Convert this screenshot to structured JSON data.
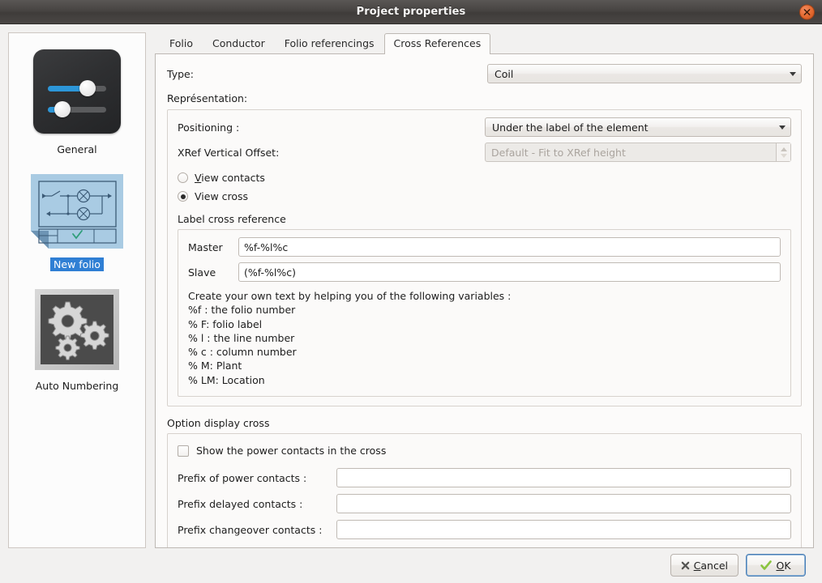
{
  "window": {
    "title": "Project properties",
    "close_icon": "close-icon"
  },
  "sidebar": {
    "items": [
      {
        "label": "General",
        "icon": "sliders-icon",
        "selected": false
      },
      {
        "label": "New folio",
        "icon": "schematic-folio-icon",
        "selected": true
      },
      {
        "label": "Auto Numbering",
        "icon": "gears-icon",
        "selected": false
      }
    ]
  },
  "tabs": [
    {
      "label": "Folio",
      "active": false
    },
    {
      "label": "Conductor",
      "active": false
    },
    {
      "label": "Folio referencings",
      "active": false
    },
    {
      "label": "Cross References",
      "active": true
    }
  ],
  "cross_references": {
    "type_label": "Type:",
    "type_value": "Coil",
    "representation_label": "Représentation:",
    "positioning_label": "Positioning :",
    "positioning_value": "Under the label of the element",
    "xref_offset_label": "XRef Vertical Offset:",
    "xref_offset_placeholder": "Default - Fit to XRef height",
    "xref_offset_value": "",
    "radio_view_contacts": "View contacts",
    "radio_view_contacts_selected": false,
    "radio_view_cross": "View cross",
    "radio_view_cross_selected": true,
    "label_cross_reference_group": "Label cross reference",
    "master_label": "Master",
    "master_value": "%f-%l%c",
    "slave_label": "Slave",
    "slave_value": "(%f-%l%c)",
    "help_text": "Create your own text by helping you of the following variables :\n%f : the folio number\n% F: folio label\n% l : the line number\n% c : column number\n% M: Plant\n% LM: Location",
    "option_display_group": "Option display cross",
    "show_power_contacts_label": "Show the power contacts in the cross",
    "show_power_contacts_checked": false,
    "prefix_power_label": "Prefix of power contacts :",
    "prefix_power_value": "",
    "prefix_delayed_label": "Prefix delayed contacts :",
    "prefix_delayed_value": "",
    "prefix_changeover_label": "Prefix changeover contacts :",
    "prefix_changeover_value": ""
  },
  "buttons": {
    "cancel": "Cancel",
    "cancel_icon": "cross-mark-icon",
    "ok": "OK",
    "ok_icon": "check-mark-icon"
  },
  "colors": {
    "titlebar": "#474442",
    "close": "#e4692f",
    "selection": "#2f7fd4",
    "panel": "#fcfbfa",
    "accent_blue": "#2c96d8",
    "check_green": "#8ac43f"
  }
}
